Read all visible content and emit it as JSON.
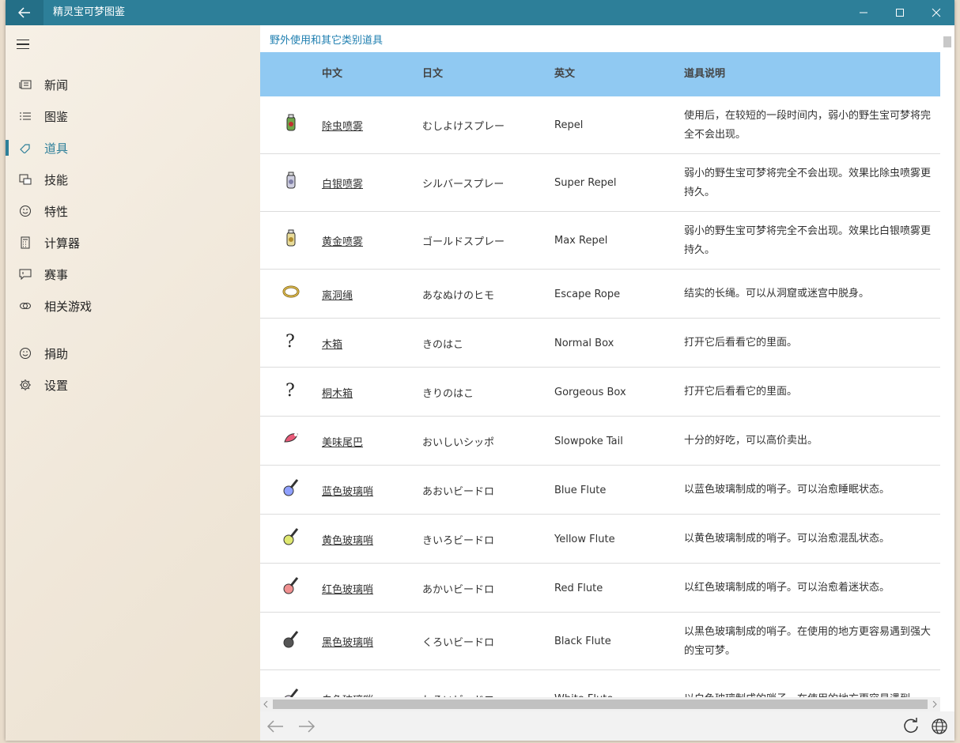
{
  "window": {
    "title": "精灵宝可梦图鉴"
  },
  "sidebar": {
    "items": [
      {
        "label": "新闻",
        "icon": "news-icon"
      },
      {
        "label": "图鉴",
        "icon": "list-icon"
      },
      {
        "label": "道具",
        "icon": "tag-icon",
        "active": true
      },
      {
        "label": "技能",
        "icon": "skill-icon"
      },
      {
        "label": "特性",
        "icon": "smile-icon"
      },
      {
        "label": "计算器",
        "icon": "calculator-icon"
      },
      {
        "label": "赛事",
        "icon": "chat-icon"
      },
      {
        "label": "相关游戏",
        "icon": "link-icon"
      },
      {
        "label": "捐助",
        "icon": "smile-icon"
      },
      {
        "label": "设置",
        "icon": "gear-icon"
      }
    ]
  },
  "main": {
    "section_title": "野外使用和其它类别道具",
    "columns": [
      "中文",
      "日文",
      "英文",
      "道具说明"
    ],
    "rows": [
      {
        "icon": "repel-icon",
        "cn": "除虫喷雾",
        "jp": "むしよけスプレー",
        "en": "Repel",
        "desc": "使用后，在较短的一段时间内，弱小的野生宝可梦将完全不会出现。"
      },
      {
        "icon": "super-repel-icon",
        "cn": "白银喷雾",
        "jp": "シルバースプレー",
        "en": "Super Repel",
        "desc": "弱小的野生宝可梦将完全不会出现。效果比除虫喷雾更持久。"
      },
      {
        "icon": "max-repel-icon",
        "cn": "黄金喷雾",
        "jp": "ゴールドスプレー",
        "en": "Max Repel",
        "desc": "弱小的野生宝可梦将完全不会出现。效果比白银喷雾更持久。"
      },
      {
        "icon": "escape-rope-icon",
        "cn": "离洞绳",
        "jp": "あなぬけのヒモ",
        "en": "Escape Rope",
        "desc": "结实的长绳。可以从洞窟或迷宫中脱身。"
      },
      {
        "icon": "question-mark-icon",
        "cn": "木箱",
        "jp": "きのはこ",
        "en": "Normal Box",
        "desc": "打开它后看看它的里面。"
      },
      {
        "icon": "question-mark-icon",
        "cn": "桐木箱",
        "jp": "きりのはこ",
        "en": "Gorgeous Box",
        "desc": "打开它后看看它的里面。"
      },
      {
        "icon": "slowpoke-tail-icon",
        "cn": "美味尾巴",
        "jp": "おいしいシッポ",
        "en": "Slowpoke Tail",
        "desc": "十分的好吃，可以高价卖出。"
      },
      {
        "icon": "blue-flute-icon",
        "cn": "蓝色玻璃哨",
        "jp": "あおいビードロ",
        "en": "Blue Flute",
        "desc": "以蓝色玻璃制成的哨子。可以治愈睡眠状态。"
      },
      {
        "icon": "yellow-flute-icon",
        "cn": "黄色玻璃哨",
        "jp": "きいろビードロ",
        "en": "Yellow Flute",
        "desc": "以黄色玻璃制成的哨子。可以治愈混乱状态。"
      },
      {
        "icon": "red-flute-icon",
        "cn": "红色玻璃哨",
        "jp": "あかいビードロ",
        "en": "Red Flute",
        "desc": "以红色玻璃制成的哨子。可以治愈着迷状态。"
      },
      {
        "icon": "black-flute-icon",
        "cn": "黑色玻璃哨",
        "jp": "くろいビードロ",
        "en": "Black Flute",
        "desc": "以黑色玻璃制成的哨子。在使用的地方更容易遇到强大的宝可梦。"
      },
      {
        "icon": "white-flute-icon",
        "cn": "白色玻璃哨",
        "jp": "しろいビードロ",
        "en": "White Flute",
        "desc": "以白色玻璃制成的哨子。在使用的地方更容易遇到"
      }
    ]
  },
  "colors": {
    "titlebar": "#2d7f99",
    "accent": "#2d7f99",
    "header": "#90c9f2",
    "link": "#1f7fb0"
  }
}
